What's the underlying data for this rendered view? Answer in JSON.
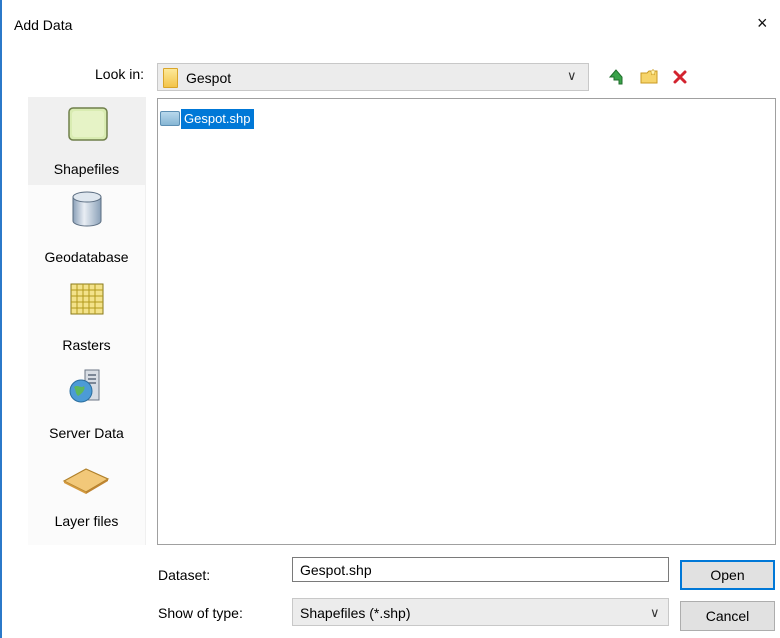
{
  "dialog": {
    "title": "Add Data",
    "close_glyph": "×"
  },
  "look_in": {
    "label": "Look in:",
    "value": "Gespot",
    "icon": "folder-icon",
    "arrow": "∨"
  },
  "toolbar": {
    "icons": [
      "up-one-level-icon",
      "new-folder-icon",
      "delete-icon"
    ]
  },
  "places": [
    {
      "label": "Shapefiles",
      "icon": "shapefile-icon",
      "selected": true
    },
    {
      "label": "Geodatabase",
      "icon": "geodatabase-icon",
      "selected": false
    },
    {
      "label": "Rasters",
      "icon": "raster-grid-icon",
      "selected": false
    },
    {
      "label": "Server Data",
      "icon": "server-globe-icon",
      "selected": false
    },
    {
      "label": "Layer files",
      "icon": "layer-file-icon",
      "selected": false
    }
  ],
  "files": [
    {
      "name": "Gespot.shp",
      "icon": "shapefile-small-icon",
      "selected": true
    }
  ],
  "dataset": {
    "label": "Dataset:",
    "value": "Gespot.shp"
  },
  "show_of_type": {
    "label": "Show of type:",
    "value": "Shapefiles (*.shp)",
    "arrow": "∨"
  },
  "buttons": {
    "open": "Open",
    "cancel": "Cancel"
  },
  "colors": {
    "selection": "#0078d7",
    "accent_border": "#0078d7"
  }
}
